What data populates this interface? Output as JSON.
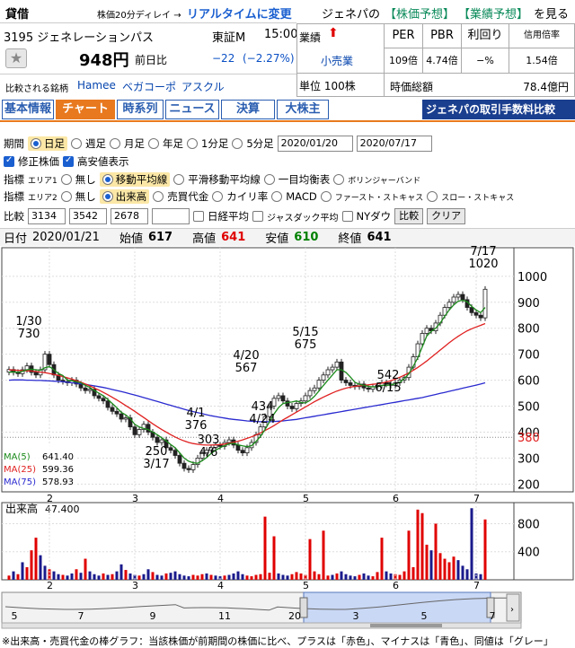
{
  "header": {
    "lending": "貸借",
    "delay_note": "株価20分ディレイ →",
    "realtime_link": "リアルタイムに変更",
    "code_name": "3195 ジェネレーションパス",
    "market": "東証M",
    "time": "15:00",
    "price": "948円",
    "change_label": "前日比",
    "change": "−22",
    "change_pct": "(−2.27%)",
    "compare_label": "比較される銘柄",
    "compare_links": [
      "Hamee",
      "ベガコーポ",
      "アスクル"
    ],
    "genepa": "ジェネパの",
    "predict_price": "【株価予想】",
    "predict_perf": "【業績予想】",
    "see": "を見る",
    "perf_label": "業績",
    "sector": "小売業",
    "unit": "単位 100株",
    "per_label": "PER",
    "pbr_label": "PBR",
    "yield_label": "利回り",
    "margin_label": "信用倍率",
    "per": "109倍",
    "pbr": "4.74倍",
    "yield": "−%",
    "margin": "1.54倍",
    "mcap_label": "時価総額",
    "mcap": "78.4億円"
  },
  "tabs": [
    "基本情報",
    "チャート",
    "時系列",
    "ニュース",
    "決算",
    "大株主"
  ],
  "banner": "ジェネパの取引手数料比較",
  "controls": {
    "period_label": "期間",
    "periods": [
      "日足",
      "週足",
      "月足",
      "年足",
      "1分足",
      "5分足"
    ],
    "date_from": "2020/01/20",
    "date_to": "2020/07/17",
    "adj_label": "修正株価",
    "hilo_label": "高安値表示",
    "ind1_label": "指標",
    "area1": "エリア1",
    "ind1_opts": [
      "無し",
      "移動平均線",
      "平滑移動平均線",
      "一目均衡表",
      "ボリンジャーバンド"
    ],
    "ind2_label": "指標",
    "area2": "エリア2",
    "ind2_opts": [
      "無し",
      "出来高",
      "売買代金",
      "カイリ率",
      "MACD",
      "ファースト・ストキャス",
      "スロー・ストキャス"
    ],
    "compare_label": "比較",
    "compare_codes": [
      "3134",
      "3542",
      "2678",
      ""
    ],
    "compare_idx": [
      "日経平均",
      "ジャスダック平均",
      "NYダウ"
    ],
    "compare_btn": "比較",
    "clear_btn": "クリア"
  },
  "quote": {
    "date_label": "日付",
    "date": "2020/01/21",
    "open_label": "始値",
    "open": "617",
    "high_label": "高値",
    "high": "641",
    "low_label": "安値",
    "low": "610",
    "close_label": "終値",
    "close": "641"
  },
  "colors": {
    "up": "#e00000",
    "down": "#1a1a8c",
    "ma5": "#1a8a1a",
    "ma25": "#e02020",
    "ma75": "#2a2ad0"
  },
  "chart_data": {
    "type": "line",
    "title": "",
    "yticks": [
      200,
      300,
      400,
      500,
      600,
      700,
      800,
      900,
      1000
    ],
    "ylim": [
      170,
      1110
    ],
    "x_month_labels": [
      "2",
      "3",
      "4",
      "5",
      "6",
      "7"
    ],
    "current_price_marker": 380,
    "legend": [
      {
        "name": "MA(5)",
        "value": "641.40"
      },
      {
        "name": "MA(25)",
        "value": "599.36"
      },
      {
        "name": "MA(75)",
        "value": "578.93"
      }
    ],
    "closes": [
      641,
      630,
      625,
      640,
      655,
      630,
      620,
      640,
      700,
      660,
      620,
      600,
      595,
      590,
      600,
      585,
      570,
      560,
      565,
      540,
      530,
      520,
      495,
      480,
      470,
      450,
      455,
      420,
      390,
      410,
      430,
      400,
      380,
      360,
      370,
      340,
      330,
      310,
      280,
      260,
      255,
      275,
      300,
      320,
      330,
      340,
      350,
      345,
      360,
      370,
      350,
      330,
      320,
      340,
      360,
      390,
      420,
      460,
      500,
      530,
      540,
      520,
      500,
      490,
      510,
      520,
      540,
      560,
      570,
      600,
      620,
      640,
      650,
      670,
      600,
      590,
      580,
      575,
      585,
      570,
      565,
      575,
      580,
      590,
      585,
      580,
      590,
      600,
      610,
      650,
      690,
      740,
      780,
      800,
      790,
      820,
      850,
      880,
      900,
      920,
      930,
      910,
      880,
      860,
      850,
      840,
      950
    ],
    "ma5": [
      630,
      632,
      630,
      634,
      640,
      642,
      640,
      638,
      648,
      652,
      640,
      626,
      618,
      600,
      598,
      594,
      590,
      580,
      572,
      560,
      550,
      540,
      526,
      510,
      494,
      476,
      466,
      452,
      430,
      420,
      414,
      410,
      400,
      390,
      378,
      366,
      352,
      340,
      320,
      300,
      288,
      282,
      280,
      290,
      302,
      318,
      330,
      340,
      348,
      355,
      357,
      351,
      347,
      344,
      348,
      364,
      384,
      410,
      440,
      470,
      494,
      510,
      514,
      516,
      520,
      514,
      512,
      522,
      538,
      558,
      580,
      600,
      620,
      640,
      640,
      630,
      612,
      592,
      584,
      580,
      576,
      574,
      575,
      580,
      580,
      582,
      586,
      592,
      606,
      624,
      654,
      686,
      728,
      770,
      788,
      800,
      820,
      846,
      870,
      890,
      904,
      908,
      902,
      884,
      870,
      860,
      880
    ],
    "ma25": [
      640,
      639,
      638,
      637,
      636,
      635,
      633,
      631,
      629,
      626,
      622,
      618,
      614,
      609,
      604,
      598,
      592,
      585,
      578,
      570,
      562,
      553,
      544,
      534,
      524,
      513,
      502,
      491,
      480,
      468,
      456,
      444,
      432,
      421,
      410,
      400,
      390,
      381,
      373,
      366,
      360,
      356,
      353,
      351,
      350,
      350,
      351,
      352,
      354,
      357,
      361,
      365,
      370,
      376,
      382,
      389,
      397,
      406,
      415,
      425,
      436,
      447,
      457,
      467,
      477,
      487,
      497,
      507,
      517,
      526,
      535,
      543,
      551,
      558,
      564,
      569,
      573,
      576,
      578,
      580,
      582,
      584,
      586,
      589,
      593,
      598,
      604,
      611,
      619,
      628,
      638,
      649,
      661,
      674,
      688,
      702,
      716,
      730,
      744,
      757,
      769,
      780,
      790,
      798,
      805,
      811,
      818
    ],
    "ma75": [
      600,
      601,
      601,
      601,
      600,
      600,
      599,
      599,
      598,
      597,
      596,
      595,
      594,
      592,
      590,
      588,
      586,
      584,
      581,
      578,
      575,
      572,
      568,
      564,
      560,
      556,
      552,
      547,
      543,
      538,
      533,
      528,
      523,
      518,
      513,
      508,
      503,
      498,
      493,
      488,
      483,
      479,
      475,
      471,
      467,
      463,
      460,
      457,
      454,
      451,
      449,
      447,
      445,
      443,
      442,
      441,
      440,
      440,
      440,
      441,
      442,
      443,
      445,
      447,
      449,
      452,
      455,
      458,
      461,
      464,
      467,
      470,
      473,
      476,
      479,
      482,
      485,
      488,
      491,
      494,
      497,
      500,
      503,
      506,
      509,
      512,
      515,
      518,
      521,
      524,
      527,
      530,
      533,
      537,
      541,
      545,
      549,
      553,
      557,
      561,
      565,
      569,
      573,
      577,
      581,
      585,
      590
    ],
    "annotations": [
      {
        "label": "1/30",
        "value": "730"
      },
      {
        "label": "3/17",
        "value": "250"
      },
      {
        "label": "4/1",
        "value": "376"
      },
      {
        "label": "4/6",
        "value": "303"
      },
      {
        "label": "4/20",
        "value": "567"
      },
      {
        "label": "4/24",
        "value": "434"
      },
      {
        "label": "5/15",
        "value": "675"
      },
      {
        "label": "6/15",
        "value": "542"
      },
      {
        "label": "7/17",
        "value": "1020"
      }
    ],
    "volume": {
      "label": "出来高",
      "current": "47.400",
      "yticks": [
        400,
        800
      ],
      "ylim": [
        0,
        1100
      ],
      "values": [
        60,
        120,
        80,
        250,
        180,
        420,
        600,
        350,
        200,
        150,
        120,
        80,
        70,
        60,
        90,
        150,
        100,
        300,
        120,
        80,
        60,
        90,
        70,
        80,
        120,
        220,
        140,
        90,
        70,
        60,
        80,
        150,
        110,
        70,
        60,
        90,
        100,
        120,
        80,
        60,
        50,
        70,
        60,
        80,
        90,
        70,
        60,
        50,
        60,
        70,
        90,
        120,
        80,
        60,
        50,
        70,
        80,
        900,
        100,
        620,
        90,
        70,
        60,
        80,
        110,
        90,
        70,
        580,
        120,
        80,
        700,
        60,
        70,
        90,
        120,
        80,
        60,
        50,
        70,
        90,
        60,
        50,
        110,
        600,
        120,
        90,
        80,
        70,
        120,
        700,
        180,
        1000,
        950,
        500,
        420,
        800,
        380,
        300,
        250,
        330,
        280,
        200,
        150,
        1020,
        90,
        80,
        860
      ],
      "up": [
        true,
        false,
        true,
        false,
        true,
        true,
        true,
        false,
        false,
        true,
        false,
        false,
        true,
        false,
        false,
        true,
        false,
        true,
        false,
        false,
        false,
        true,
        false,
        true,
        false,
        false,
        true,
        false,
        false,
        true,
        false,
        false,
        true,
        false,
        false,
        true,
        false,
        false,
        false,
        false,
        false,
        true,
        true,
        true,
        false,
        true,
        false,
        false,
        true,
        false,
        false,
        false,
        false,
        true,
        true,
        true,
        true,
        true,
        true,
        true,
        false,
        false,
        false,
        true,
        true,
        true,
        true,
        true,
        true,
        true,
        true,
        true,
        false,
        true,
        false,
        false,
        false,
        false,
        true,
        false,
        false,
        true,
        true,
        true,
        false,
        false,
        true,
        true,
        true,
        true,
        true,
        true,
        true,
        true,
        false,
        true,
        true,
        true,
        true,
        true,
        false,
        false,
        false,
        false,
        false,
        false,
        true
      ]
    },
    "navigator": {
      "labels": [
        "5",
        "7",
        "9",
        "11",
        "20",
        "3",
        "5",
        "7"
      ]
    }
  },
  "footnote": "※出来高・売買代金の棒グラフ：当該株価が前期間の株価に比べ、プラスは「赤色」、マイナスは「青色」、同値は「グレー」"
}
